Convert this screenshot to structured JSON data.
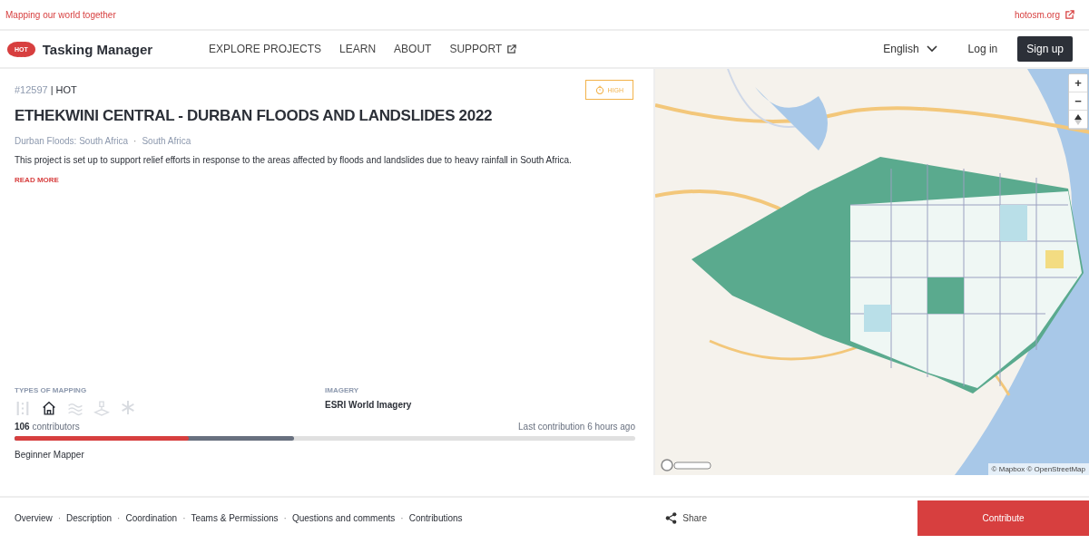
{
  "top_bar": {
    "tagline": "Mapping our world together",
    "link": "hotosm.org"
  },
  "header": {
    "logo_badge": "HOT",
    "app_name": "Tasking Manager",
    "nav": [
      {
        "label": "EXPLORE PROJECTS",
        "external": false
      },
      {
        "label": "LEARN",
        "external": false
      },
      {
        "label": "ABOUT",
        "external": false
      },
      {
        "label": "SUPPORT",
        "external": true
      }
    ],
    "language": "English",
    "login": "Log in",
    "signup": "Sign up"
  },
  "project": {
    "id": "#12597",
    "id_separator": "|",
    "organisation": "HOT",
    "campaign_separator": "·",
    "priority": "HIGH",
    "title": "ETHEKWINI CENTRAL - DURBAN FLOODS AND LANDSLIDES 2022",
    "campaigns": [
      "Durban Floods: South Africa",
      "South Africa"
    ],
    "description": "This project is set up to support relief efforts in response to the areas affected by floods and landslides due to heavy rainfall in South Africa.",
    "read_more": "READ MORE",
    "types_heading": "TYPES OF MAPPING",
    "mapping_types": [
      {
        "kind": "roads",
        "selected": false
      },
      {
        "kind": "buildings",
        "selected": true
      },
      {
        "kind": "waterways",
        "selected": false
      },
      {
        "kind": "landuse",
        "selected": false
      },
      {
        "kind": "other",
        "selected": false
      }
    ],
    "imagery_heading": "IMAGERY",
    "imagery": "ESRI World Imagery",
    "contributors_count": "106",
    "contributors_label": "contributors",
    "last_contribution": "Last contribution 6 hours ago",
    "progress": [
      {
        "level": 0.28,
        "color": "#d73f3f"
      },
      {
        "level": 0.45,
        "color": "#68707f"
      }
    ],
    "difficulty": "Beginner Mapper"
  },
  "map": {
    "attribution": "© Mapbox © OpenStreetMap",
    "controls": [
      "+",
      "−"
    ]
  },
  "footer": {
    "separator": "·",
    "sections": [
      "Overview",
      "Description",
      "Coordination",
      "Teams & Permissions",
      "Questions and comments",
      "Contributions"
    ],
    "share": "Share",
    "contribute": "Contribute"
  }
}
